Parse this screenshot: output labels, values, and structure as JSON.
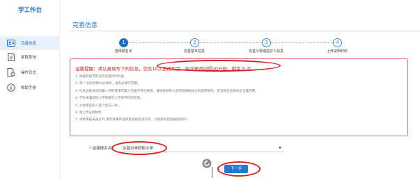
{
  "sidebar": {
    "title": "学工作台",
    "items": [
      {
        "label": "完善信息",
        "icon": "id-card-icon",
        "active": true
      },
      {
        "label": "录取查询",
        "icon": "document-icon",
        "active": false
      },
      {
        "label": "操作日志",
        "icon": "log-icon",
        "active": false
      },
      {
        "label": "帮助手册",
        "icon": "info-icon",
        "active": false
      }
    ]
  },
  "page": {
    "title": "完善信息"
  },
  "steps": [
    {
      "number": "1",
      "label": "选择报名点",
      "active": true
    },
    {
      "number": "2",
      "label": "完善基本信息",
      "active": false
    },
    {
      "number": "3",
      "label": "完善父母或监护人信息",
      "active": false
    },
    {
      "number": "4",
      "label": "上传证明材料",
      "active": false
    }
  ],
  "notice": {
    "title": "温馨提醒：请认真填写下列信息，您有10次更改机会，每次更改间隔20分钟，剩余 9 次",
    "items": [
      "1. 依据有劲市民已的深度时间为准",
      "2. 带 * 号的项目为必填项，请务必填写完整。",
      "3. 红色边框标识的输入项目或填写输入内容不符合要求，请将鼠标移入该项后根据给出的说明修改。登记的信息请务必全面完整。",
      "4. 学生未满足招入学请填写入学前学校所在地。",
      "5. 父母或监护人至少登记一条。",
      "6. 请上传证明材料",
      "7. 资格审核未通过时,请尽快重新选择其他报名点学校，以免影响后续录取操作！"
    ]
  },
  "form": {
    "label_required": "*",
    "label": "选择报名点",
    "selected_value": "许昌市学府街小学"
  },
  "actions": {
    "next_label": "下一步"
  },
  "colors": {
    "primary": "#1f6fbf",
    "annotation": "#d42020",
    "notice_border": "#e06b6b"
  }
}
